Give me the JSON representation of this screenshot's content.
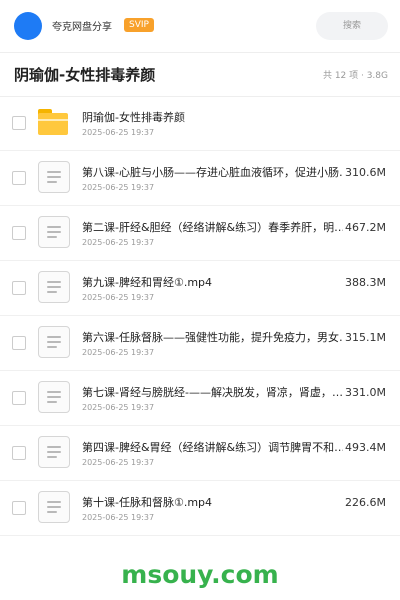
{
  "header": {
    "app_name": "夸克网盘分享",
    "badge": "SVIP",
    "search_placeholder": "搜索"
  },
  "page": {
    "title": "阴瑜伽-女性排毒养颜",
    "meta": "共 12 项 · 3.8G"
  },
  "files": [
    {
      "type": "folder",
      "name": "阴瑜伽-女性排毒养颜",
      "date": "2025-06-25 19:37",
      "size": ""
    },
    {
      "type": "doc",
      "name": "第八课-心脏与小肠——存进心脏血液循环，促进小肠吸收",
      "date": "2025-06-25 19:37",
      "size": "310.6M"
    },
    {
      "type": "doc",
      "name": "第二课-肝经&胆经（经络讲解&练习）春季养肝，明目…",
      "date": "2025-06-25 19:37",
      "size": "467.2M"
    },
    {
      "type": "doc",
      "name": "第九课-脾经和胃经①.mp4",
      "date": "2025-06-25 19:37",
      "size": "388.3M"
    },
    {
      "type": "doc",
      "name": "第六课-任脉督脉——强健性功能，提升免疫力，男女通用",
      "date": "2025-06-25 19:37",
      "size": "315.1M"
    },
    {
      "type": "doc",
      "name": "第七课-肾经与膀胱经-——解决脱发，肾凉，肾虚，尿…",
      "date": "2025-06-25 19:37",
      "size": "331.0M"
    },
    {
      "type": "doc",
      "name": "第四课-脾经&胃经（经络讲解&练习）调节脾胃不和，…",
      "date": "2025-06-25 19:37",
      "size": "493.4M"
    },
    {
      "type": "doc",
      "name": "第十课-任脉和督脉①.mp4",
      "date": "2025-06-25 19:37",
      "size": "226.6M"
    }
  ],
  "footer": {
    "brand": "msouy.com"
  }
}
